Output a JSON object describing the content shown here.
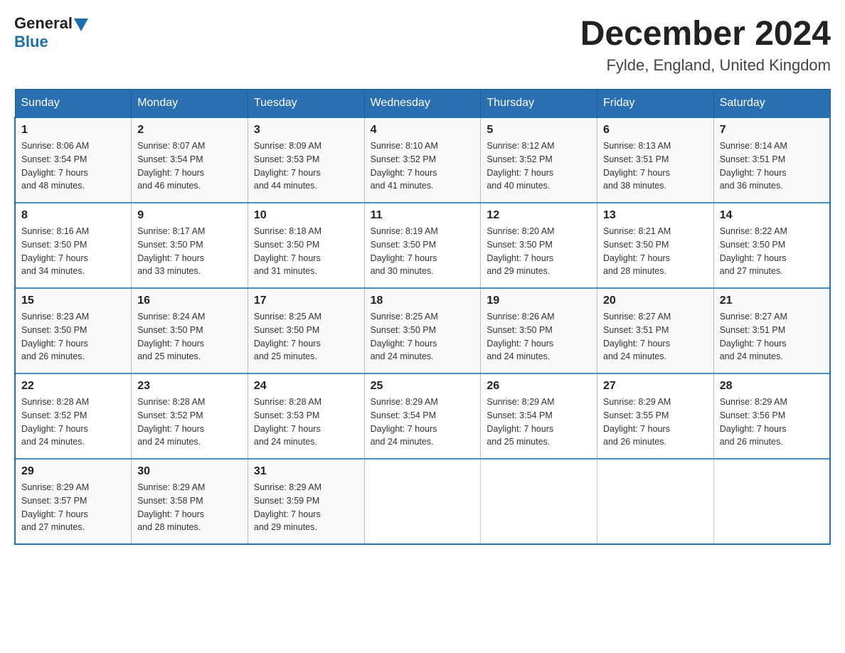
{
  "header": {
    "logo_general": "General",
    "logo_blue": "Blue",
    "main_title": "December 2024",
    "subtitle": "Fylde, England, United Kingdom"
  },
  "weekdays": [
    "Sunday",
    "Monday",
    "Tuesday",
    "Wednesday",
    "Thursday",
    "Friday",
    "Saturday"
  ],
  "weeks": [
    [
      {
        "day": "1",
        "sunrise": "8:06 AM",
        "sunset": "3:54 PM",
        "daylight": "7 hours and 48 minutes."
      },
      {
        "day": "2",
        "sunrise": "8:07 AM",
        "sunset": "3:54 PM",
        "daylight": "7 hours and 46 minutes."
      },
      {
        "day": "3",
        "sunrise": "8:09 AM",
        "sunset": "3:53 PM",
        "daylight": "7 hours and 44 minutes."
      },
      {
        "day": "4",
        "sunrise": "8:10 AM",
        "sunset": "3:52 PM",
        "daylight": "7 hours and 41 minutes."
      },
      {
        "day": "5",
        "sunrise": "8:12 AM",
        "sunset": "3:52 PM",
        "daylight": "7 hours and 40 minutes."
      },
      {
        "day": "6",
        "sunrise": "8:13 AM",
        "sunset": "3:51 PM",
        "daylight": "7 hours and 38 minutes."
      },
      {
        "day": "7",
        "sunrise": "8:14 AM",
        "sunset": "3:51 PM",
        "daylight": "7 hours and 36 minutes."
      }
    ],
    [
      {
        "day": "8",
        "sunrise": "8:16 AM",
        "sunset": "3:50 PM",
        "daylight": "7 hours and 34 minutes."
      },
      {
        "day": "9",
        "sunrise": "8:17 AM",
        "sunset": "3:50 PM",
        "daylight": "7 hours and 33 minutes."
      },
      {
        "day": "10",
        "sunrise": "8:18 AM",
        "sunset": "3:50 PM",
        "daylight": "7 hours and 31 minutes."
      },
      {
        "day": "11",
        "sunrise": "8:19 AM",
        "sunset": "3:50 PM",
        "daylight": "7 hours and 30 minutes."
      },
      {
        "day": "12",
        "sunrise": "8:20 AM",
        "sunset": "3:50 PM",
        "daylight": "7 hours and 29 minutes."
      },
      {
        "day": "13",
        "sunrise": "8:21 AM",
        "sunset": "3:50 PM",
        "daylight": "7 hours and 28 minutes."
      },
      {
        "day": "14",
        "sunrise": "8:22 AM",
        "sunset": "3:50 PM",
        "daylight": "7 hours and 27 minutes."
      }
    ],
    [
      {
        "day": "15",
        "sunrise": "8:23 AM",
        "sunset": "3:50 PM",
        "daylight": "7 hours and 26 minutes."
      },
      {
        "day": "16",
        "sunrise": "8:24 AM",
        "sunset": "3:50 PM",
        "daylight": "7 hours and 25 minutes."
      },
      {
        "day": "17",
        "sunrise": "8:25 AM",
        "sunset": "3:50 PM",
        "daylight": "7 hours and 25 minutes."
      },
      {
        "day": "18",
        "sunrise": "8:25 AM",
        "sunset": "3:50 PM",
        "daylight": "7 hours and 24 minutes."
      },
      {
        "day": "19",
        "sunrise": "8:26 AM",
        "sunset": "3:50 PM",
        "daylight": "7 hours and 24 minutes."
      },
      {
        "day": "20",
        "sunrise": "8:27 AM",
        "sunset": "3:51 PM",
        "daylight": "7 hours and 24 minutes."
      },
      {
        "day": "21",
        "sunrise": "8:27 AM",
        "sunset": "3:51 PM",
        "daylight": "7 hours and 24 minutes."
      }
    ],
    [
      {
        "day": "22",
        "sunrise": "8:28 AM",
        "sunset": "3:52 PM",
        "daylight": "7 hours and 24 minutes."
      },
      {
        "day": "23",
        "sunrise": "8:28 AM",
        "sunset": "3:52 PM",
        "daylight": "7 hours and 24 minutes."
      },
      {
        "day": "24",
        "sunrise": "8:28 AM",
        "sunset": "3:53 PM",
        "daylight": "7 hours and 24 minutes."
      },
      {
        "day": "25",
        "sunrise": "8:29 AM",
        "sunset": "3:54 PM",
        "daylight": "7 hours and 24 minutes."
      },
      {
        "day": "26",
        "sunrise": "8:29 AM",
        "sunset": "3:54 PM",
        "daylight": "7 hours and 25 minutes."
      },
      {
        "day": "27",
        "sunrise": "8:29 AM",
        "sunset": "3:55 PM",
        "daylight": "7 hours and 26 minutes."
      },
      {
        "day": "28",
        "sunrise": "8:29 AM",
        "sunset": "3:56 PM",
        "daylight": "7 hours and 26 minutes."
      }
    ],
    [
      {
        "day": "29",
        "sunrise": "8:29 AM",
        "sunset": "3:57 PM",
        "daylight": "7 hours and 27 minutes."
      },
      {
        "day": "30",
        "sunrise": "8:29 AM",
        "sunset": "3:58 PM",
        "daylight": "7 hours and 28 minutes."
      },
      {
        "day": "31",
        "sunrise": "8:29 AM",
        "sunset": "3:59 PM",
        "daylight": "7 hours and 29 minutes."
      },
      null,
      null,
      null,
      null
    ]
  ],
  "labels": {
    "sunrise": "Sunrise:",
    "sunset": "Sunset:",
    "daylight": "Daylight:"
  }
}
